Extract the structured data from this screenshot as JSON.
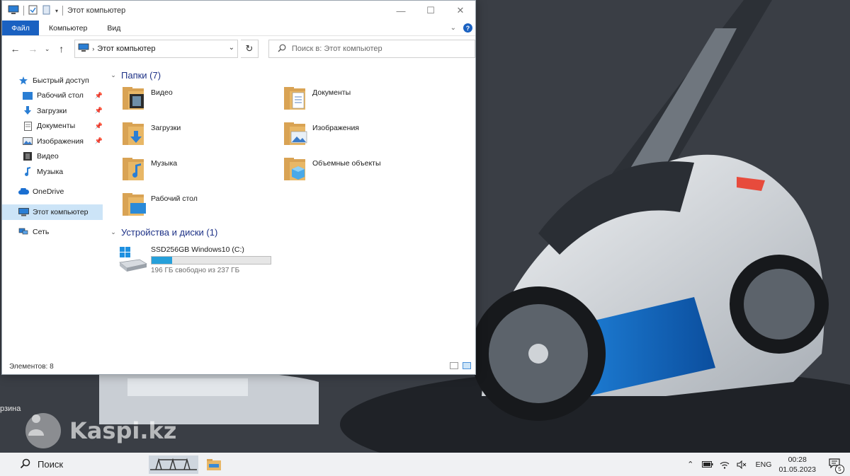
{
  "window": {
    "title": "Этот компьютер",
    "ribbon_tabs": {
      "file": "Файл",
      "computer": "Компьютер",
      "view": "Вид"
    },
    "help": "?"
  },
  "navigation": {
    "address": "Этот компьютер",
    "search_placeholder": "Поиск в: Этот компьютер"
  },
  "sidebar": {
    "quick_access": "Быстрый доступ",
    "quick_items": [
      "Рабочий стол",
      "Загрузки",
      "Документы",
      "Изображения",
      "Видео",
      "Музыка"
    ],
    "onedrive": "OneDrive",
    "this_pc": "Этот компьютер",
    "network": "Сеть"
  },
  "content": {
    "folders_header": "Папки (7)",
    "folders": [
      "Видео",
      "Документы",
      "Загрузки",
      "Изображения",
      "Музыка",
      "Объемные объекты",
      "Рабочий стол"
    ],
    "devices_header": "Устройства и диски (1)",
    "drive": {
      "name": "SSD256GB Windows10 (C:)",
      "free_text": "196 ГБ свободно из 237 ГБ",
      "used_fraction": 0.173
    }
  },
  "statusbar": {
    "items": "Элементов: 8"
  },
  "desktop": {
    "icon_label": "рзина",
    "watermark": "Kaspi.kz"
  },
  "taskbar": {
    "search": "Поиск",
    "language": "ENG",
    "time": "00:28",
    "date": "01.05.2023",
    "notifications": "5"
  },
  "colors": {
    "accent": "#1a61c1",
    "drive_fill": "#26a0da",
    "selected": "#cce4f7",
    "folder": "#e8b766"
  }
}
